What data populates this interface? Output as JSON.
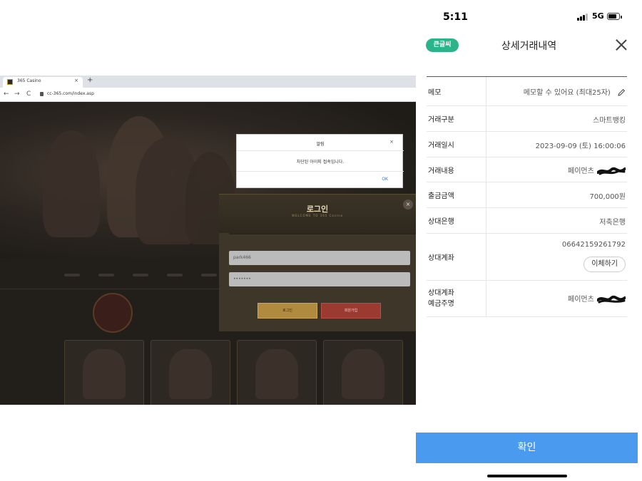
{
  "browser": {
    "tab_title": "365 Casino",
    "tab_close": "×",
    "new_tab": "+",
    "nav_back": "←",
    "nav_forward": "→",
    "nav_reload": "C",
    "url": "cc-365.com/index.asp",
    "alert": {
      "title": "알림",
      "close": "×",
      "message": "차단된 아이피 접속입니다.",
      "ok": "OK"
    },
    "login": {
      "title": "로그인",
      "subtitle": "WELCOME TO 365 Casino",
      "close": "×",
      "username": "park466",
      "password": "•••••••",
      "login_button": "로그인",
      "signup_button": "회원가입"
    }
  },
  "phone": {
    "status": {
      "time": "5:11",
      "network": "5G"
    },
    "header": {
      "badge": "큰글씨",
      "title": "상세거래내역"
    },
    "details": {
      "memo_label": "메모",
      "memo_value": "메모할 수 있어요 (최대25자)",
      "type_label": "거래구분",
      "type_value": "스마트뱅킹",
      "datetime_label": "거래일시",
      "datetime_value": "2023-09-09 (토) 16:00:06",
      "content_label": "거래내용",
      "content_value": "페이먼츠",
      "amount_label": "출금금액",
      "amount_value": "700,000원",
      "bank_label": "상대은행",
      "bank_value": "저축은행",
      "account_label": "상대계좌",
      "account_value": "06642159261792",
      "transfer_button": "이체하기",
      "holder_label_1": "상대계좌",
      "holder_label_2": "예금주명",
      "holder_value": "페이먼츠"
    },
    "confirm_button": "확인"
  }
}
